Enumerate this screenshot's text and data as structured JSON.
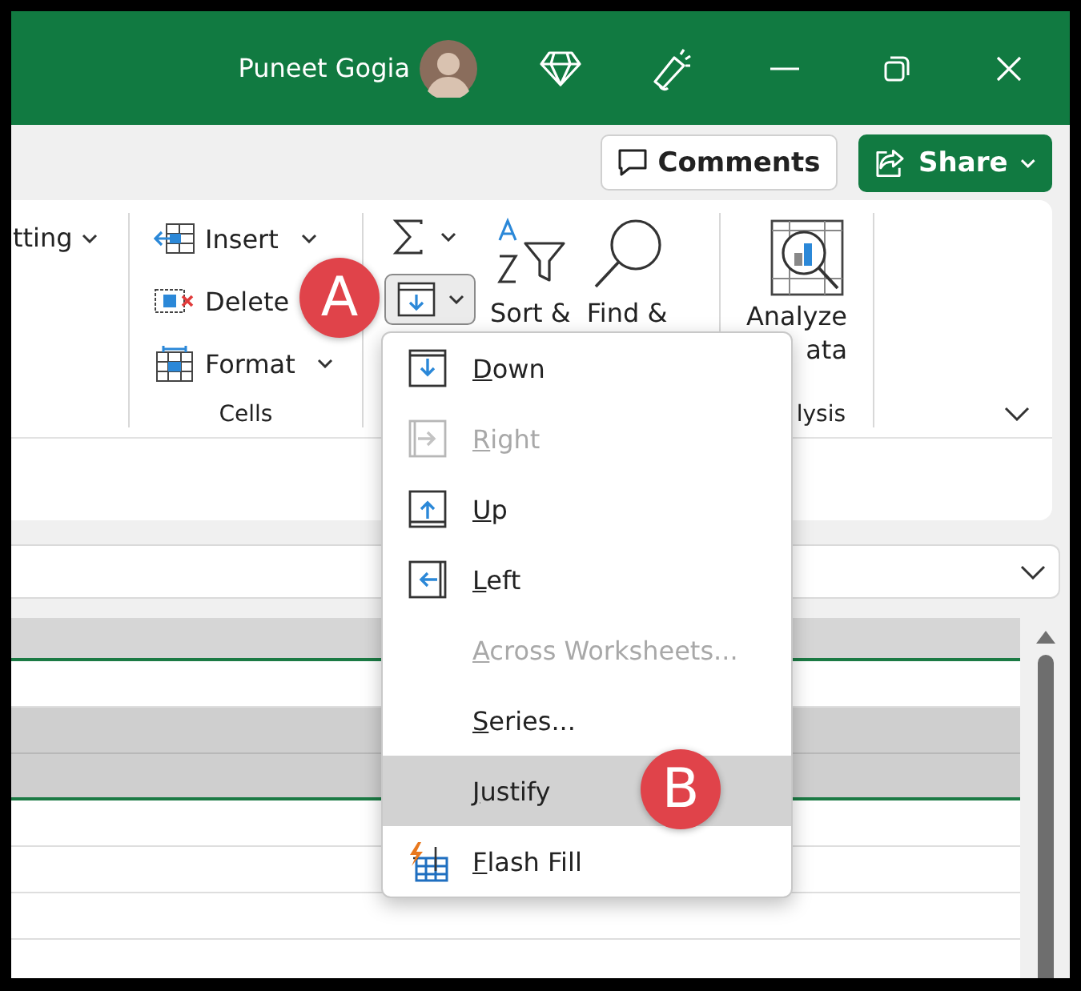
{
  "title_bar": {
    "user_name": "Puneet Gogia"
  },
  "actions": {
    "comments": "Comments",
    "share": "Share"
  },
  "ribbon": {
    "partial_group": {
      "label": "tting"
    },
    "cells": {
      "group_label": "Cells",
      "buttons": [
        {
          "label": "Insert",
          "kind": "insert",
          "has_menu": true
        },
        {
          "label": "Delete",
          "kind": "delete",
          "has_menu": false
        },
        {
          "label": "Format",
          "kind": "format",
          "has_menu": true
        }
      ]
    },
    "editing": {
      "fill_pressed": true,
      "sort_label": "Sort &",
      "find_label": "Find &"
    },
    "analysis": {
      "label_line_1": "Analyze",
      "label_line_2": "ata",
      "group_label": "lysis"
    }
  },
  "fill_menu": {
    "items": [
      {
        "key": "D",
        "rest": "own",
        "kind": "down",
        "disabled": false,
        "selected": false
      },
      {
        "key": "R",
        "rest": "ight",
        "kind": "right",
        "disabled": true,
        "selected": false
      },
      {
        "key": "U",
        "rest": "p",
        "kind": "up",
        "disabled": false,
        "selected": false
      },
      {
        "key": "L",
        "rest": "eft",
        "kind": "left",
        "disabled": false,
        "selected": false
      },
      {
        "key": "A",
        "rest": "cross Worksheets...",
        "kind": "plain",
        "disabled": true,
        "selected": false
      },
      {
        "key": "S",
        "rest": "eries...",
        "kind": "plain",
        "disabled": false,
        "selected": false
      },
      {
        "key": "J",
        "rest": "ustify",
        "kind": "plain",
        "disabled": false,
        "selected": true
      },
      {
        "key": "F",
        "rest": "lash Fill",
        "kind": "flash",
        "disabled": false,
        "selected": false
      }
    ]
  },
  "markers": [
    {
      "label": "A"
    },
    {
      "label": "B"
    }
  ],
  "sheet": {
    "rows": [
      {
        "selected": false
      },
      {
        "selected": true
      },
      {
        "selected": true
      },
      {
        "selected": false
      },
      {
        "selected": false
      },
      {
        "selected": false
      }
    ]
  }
}
